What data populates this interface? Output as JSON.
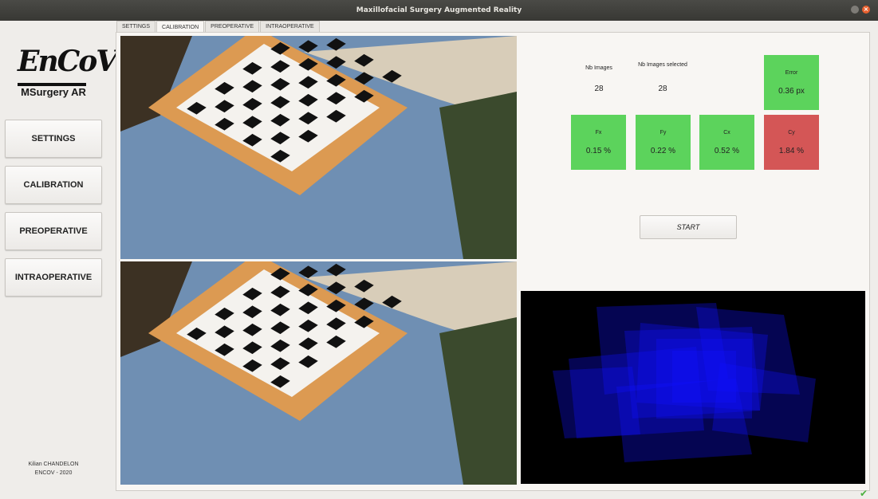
{
  "window": {
    "title": "Maxillofacial Surgery Augmented Reality"
  },
  "logo": {
    "text": "EnCoV"
  },
  "app": {
    "subtitle": "MSurgery AR"
  },
  "sidebar": {
    "buttons": [
      {
        "label": "SETTINGS"
      },
      {
        "label": "CALIBRATION"
      },
      {
        "label": "PREOPERATIVE"
      },
      {
        "label": "INTRAOPERATIVE"
      }
    ],
    "footer": {
      "author": "Kilian CHANDELON",
      "org": "ENCOV - 2020"
    }
  },
  "tabs": [
    {
      "label": "SETTINGS"
    },
    {
      "label": "CALIBRATION",
      "active": true
    },
    {
      "label": "PREOPERATIVE"
    },
    {
      "label": "INTRAOPERATIVE"
    }
  ],
  "stats": {
    "nb_images_label": "Nb Images",
    "nb_images_value": "28",
    "nb_selected_label": "Nb Images selected",
    "nb_selected_value": "28"
  },
  "metrics": {
    "error": {
      "label": "Error",
      "value": "0.36 px",
      "color": "#5cd35c"
    },
    "fx": {
      "label": "Fx",
      "value": "0.15 %",
      "color": "#5cd35c"
    },
    "fy": {
      "label": "Fy",
      "value": "0.22 %",
      "color": "#5cd35c"
    },
    "cx": {
      "label": "Cx",
      "value": "0.52 %",
      "color": "#5cd35c"
    },
    "cy": {
      "label": "Cy",
      "value": "1.84 %",
      "color": "#d45656"
    }
  },
  "start_button": {
    "label": "START"
  },
  "colors": {
    "accent_green": "#5cd35c",
    "accent_red": "#d45656",
    "coverage_blue": "#1010ff"
  }
}
